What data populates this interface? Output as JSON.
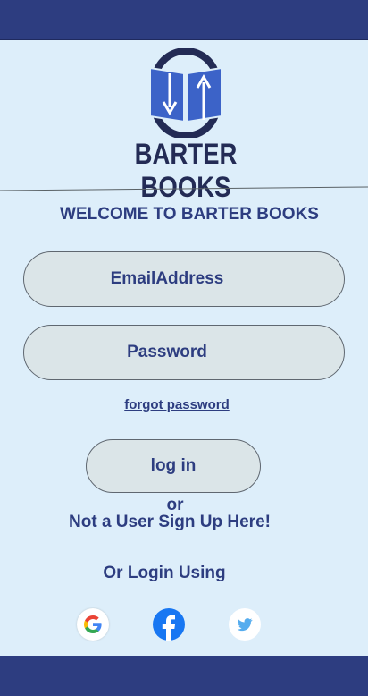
{
  "brand": {
    "name": "BARTER BOOKS",
    "logo_icon": "book-exchange-icon",
    "colors": {
      "primary": "#2d3d80",
      "logo_blue": "#3c63c8",
      "background": "#ddeefa",
      "field": "#dbe5e8"
    }
  },
  "welcome": "WELCOME TO BARTER BOOKS",
  "form": {
    "email_placeholder": "EmailAddress",
    "password_placeholder": "Password",
    "forgot_label": "forgot password",
    "login_label": "log in"
  },
  "or_text": "or",
  "signup_text": "Not a User Sign Up Here!",
  "or_login_text": "Or Login Using",
  "social": [
    {
      "name": "google",
      "icon": "google-icon"
    },
    {
      "name": "facebook",
      "icon": "facebook-icon"
    },
    {
      "name": "twitter",
      "icon": "twitter-icon"
    }
  ]
}
